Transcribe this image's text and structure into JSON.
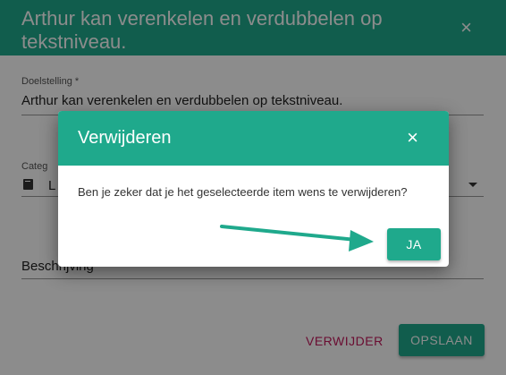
{
  "edit_dialog": {
    "title": "Arthur kan verenkelen en verdubbelen op tekstniveau.",
    "close_icon": "×",
    "goal_label": "Doelstelling *",
    "goal_value": "Arthur kan verenkelen en verdubbelen op tekstniveau.",
    "category_label": "Categ",
    "category_value": "L",
    "description_label": "Beschrijving",
    "delete_label": "VERWIJDER",
    "save_label": "OPSLAAN"
  },
  "confirm_modal": {
    "title": "Verwijderen",
    "close_icon": "×",
    "message": "Ben je zeker dat je het geselecteerde item wens te verwijderen?",
    "yes_label": "JA"
  },
  "colors": {
    "accent": "#1fa98c",
    "danger_text": "#c2185b"
  }
}
